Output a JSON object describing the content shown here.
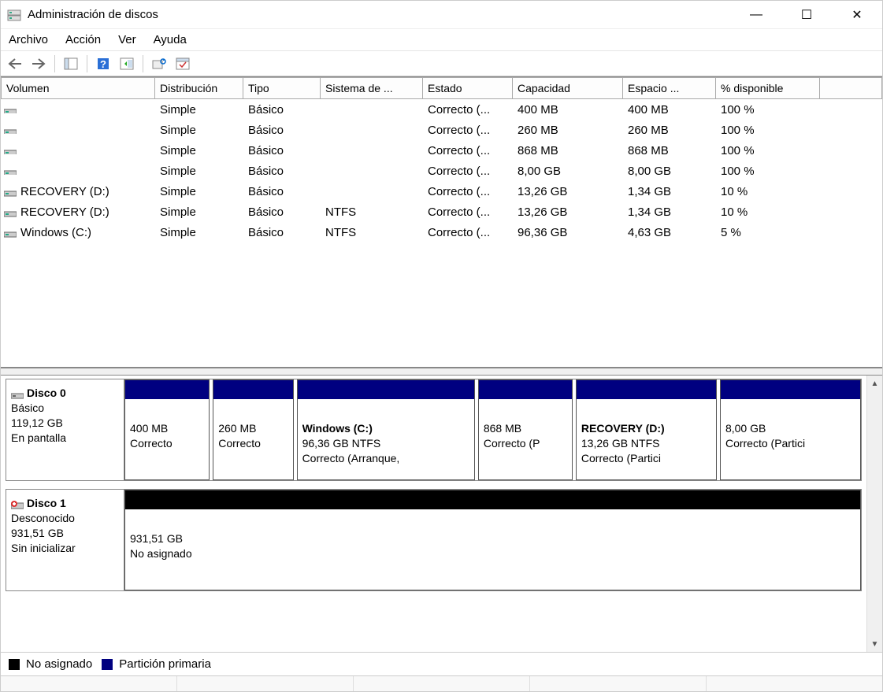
{
  "window": {
    "title": "Administración de discos"
  },
  "menu": {
    "file": "Archivo",
    "action": "Acción",
    "view": "Ver",
    "help": "Ayuda"
  },
  "columns": {
    "volume": "Volumen",
    "layout": "Distribución",
    "type": "Tipo",
    "filesystem": "Sistema de ...",
    "status": "Estado",
    "capacity": "Capacidad",
    "freespace": "Espacio ...",
    "pctfree": "% disponible"
  },
  "volumes": [
    {
      "name": "",
      "layout": "Simple",
      "type": "Básico",
      "fs": "",
      "status": "Correcto (...",
      "capacity": "400 MB",
      "free": "400 MB",
      "pct": "100 %"
    },
    {
      "name": "",
      "layout": "Simple",
      "type": "Básico",
      "fs": "",
      "status": "Correcto (...",
      "capacity": "260 MB",
      "free": "260 MB",
      "pct": "100 %"
    },
    {
      "name": "",
      "layout": "Simple",
      "type": "Básico",
      "fs": "",
      "status": "Correcto (...",
      "capacity": "868 MB",
      "free": "868 MB",
      "pct": "100 %"
    },
    {
      "name": "",
      "layout": "Simple",
      "type": "Básico",
      "fs": "",
      "status": "Correcto (...",
      "capacity": "8,00 GB",
      "free": "8,00 GB",
      "pct": "100 %"
    },
    {
      "name": "RECOVERY (D:)",
      "layout": "Simple",
      "type": "Básico",
      "fs": "",
      "status": "Correcto (...",
      "capacity": "13,26 GB",
      "free": "1,34 GB",
      "pct": "10 %"
    },
    {
      "name": "RECOVERY (D:)",
      "layout": "Simple",
      "type": "Básico",
      "fs": "NTFS",
      "status": "Correcto (...",
      "capacity": "13,26 GB",
      "free": "1,34 GB",
      "pct": "10 %"
    },
    {
      "name": "Windows (C:)",
      "layout": "Simple",
      "type": "Básico",
      "fs": "NTFS",
      "status": "Correcto (...",
      "capacity": "96,36 GB",
      "free": "4,63 GB",
      "pct": "5 %"
    }
  ],
  "disks": [
    {
      "name": "Disco 0",
      "type": "Básico",
      "size": "119,12 GB",
      "status": "En pantalla",
      "icon": "disk",
      "partitions": [
        {
          "title": "",
          "line1": "400 MB",
          "line2": "Correcto",
          "kind": "primary",
          "flex": 90
        },
        {
          "title": "",
          "line1": "260 MB",
          "line2": "Correcto",
          "kind": "primary",
          "flex": 85
        },
        {
          "title": "Windows  (C:)",
          "line1": "96,36 GB NTFS",
          "line2": "Correcto (Arranque, ",
          "kind": "primary",
          "flex": 190
        },
        {
          "title": "",
          "line1": "868 MB",
          "line2": "Correcto (P",
          "kind": "primary",
          "flex": 100
        },
        {
          "title": "RECOVERY  (D:)",
          "line1": "13,26 GB NTFS",
          "line2": "Correcto (Partici",
          "kind": "primary",
          "flex": 150
        },
        {
          "title": "",
          "line1": "8,00 GB",
          "line2": "Correcto (Partici",
          "kind": "primary",
          "flex": 150
        }
      ]
    },
    {
      "name": "Disco 1",
      "type": "Desconocido",
      "size": "931,51 GB",
      "status": "Sin inicializar",
      "icon": "disk-error",
      "partitions": [
        {
          "title": "",
          "line1": "931,51 GB",
          "line2": "No asignado",
          "kind": "unalloc",
          "flex": 1
        }
      ]
    }
  ],
  "legend": {
    "unallocated": "No asignado",
    "primary": "Partición primaria"
  }
}
